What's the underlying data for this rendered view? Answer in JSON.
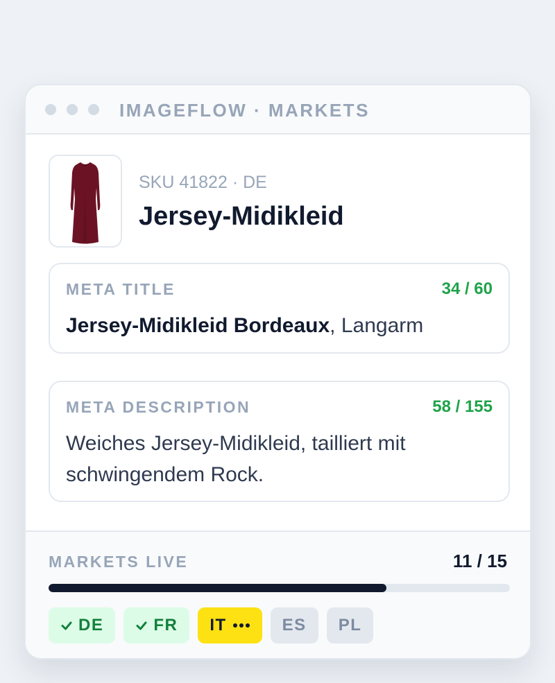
{
  "window": {
    "title": "IMAGEFLOW · MARKETS"
  },
  "product": {
    "sku_line": "SKU 41822 · DE",
    "title": "Jersey-Midikleid",
    "thumbnail_icon": "dress-icon",
    "dress_color": "#6b1325"
  },
  "meta_title": {
    "label": "META TITLE",
    "count": "34 / 60",
    "value_strong": "Jersey-Midikleid Bordeaux",
    "value_rest": ", Langarm"
  },
  "meta_description": {
    "label": "META DESCRIPTION",
    "count": "58 / 155",
    "value": "Weiches Jersey-Midikleid, tailliert mit schwingendem Rock."
  },
  "markets": {
    "label": "MARKETS LIVE",
    "count": "11 / 15",
    "progress_fraction": 0.733,
    "chips": [
      {
        "code": "DE",
        "status": "live",
        "icon": "check-icon"
      },
      {
        "code": "FR",
        "status": "live",
        "icon": "check-icon"
      },
      {
        "code": "IT",
        "status": "pending",
        "icon": "ellipsis-icon"
      },
      {
        "code": "ES",
        "status": "off"
      },
      {
        "code": "PL",
        "status": "off"
      }
    ]
  },
  "colors": {
    "accent_dark": "#111a2e",
    "success": "#1fa34a",
    "pending": "#fde113",
    "muted": "#97a5b8"
  }
}
